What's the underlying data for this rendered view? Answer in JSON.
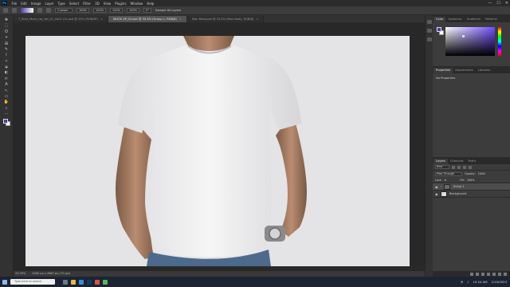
{
  "app": {
    "logo": "Ps"
  },
  "menu": [
    "File",
    "Edit",
    "Image",
    "Layer",
    "Type",
    "Select",
    "Filter",
    "3D",
    "View",
    "Plugins",
    "Window",
    "Help"
  ],
  "window_controls": [
    "—",
    "☐",
    "✕"
  ],
  "options": {
    "mode": "Custom",
    "fields": [
      "100%",
      "100%",
      "100%",
      "100%"
    ],
    "angle": "0°",
    "sample_all": "Sample All Layers"
  },
  "tabs": [
    {
      "label": "T_Shirt_Mock_Up_Vol_22_0401 (O).psd @ 25% (RGB/8*)",
      "active": false
    },
    {
      "label": "MOCK UP_02.psd @ 33.3% (Group 1, RGB/8)",
      "active": true
    },
    {
      "label": "Man Body.psd @ 33.3% (Man Body, RGB/8)",
      "active": false
    }
  ],
  "tools": [
    "✥",
    "⬚",
    "ʘ",
    "⌖",
    "⊞",
    "✎",
    "⌇",
    "✧",
    "⬙",
    "◐",
    "✍",
    "A",
    "↖",
    "▭",
    "✋",
    "⌕",
    "⋯"
  ],
  "status": {
    "zoom": "33.33%",
    "doc": "4000 px x 2667 px (72 ppi)"
  },
  "panels": {
    "color_tabs": [
      "Color",
      "Swatches",
      "Gradients",
      "Patterns"
    ],
    "properties_tabs": [
      "Properties",
      "Adjustments",
      "Libraries"
    ],
    "properties_text": "No Properties",
    "layers_tabs": [
      "Layers",
      "Channels",
      "Paths"
    ],
    "kind": "Kind",
    "blend_mode": "Pass Through",
    "opacity_label": "Opacity:",
    "opacity": "100%",
    "lock_label": "Lock:",
    "fill_label": "Fill:",
    "fill": "100%",
    "layers": [
      {
        "name": "Group 1",
        "selected": true,
        "group": true
      },
      {
        "name": "Background",
        "selected": false,
        "group": false
      }
    ]
  },
  "taskbar": {
    "search_placeholder": "Type here to search",
    "time": "10:24 AM",
    "date": "2/19/2023"
  },
  "colors": {
    "foreground": "#4b3aa8",
    "background": "#ffffff",
    "canvas_bg": "#e4e3e5"
  }
}
